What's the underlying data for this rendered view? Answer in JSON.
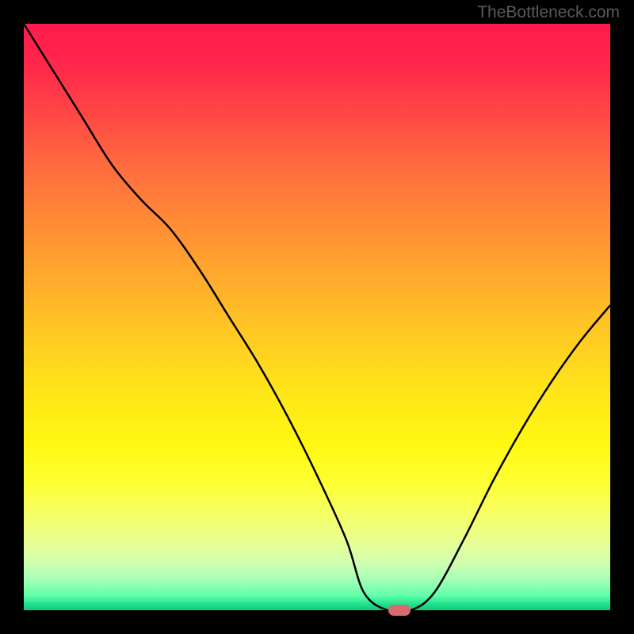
{
  "watermark": "TheBottleneck.com",
  "chart_data": {
    "type": "line",
    "title": "",
    "xlabel": "",
    "ylabel": "",
    "xlim": [
      0,
      100
    ],
    "ylim": [
      0,
      100
    ],
    "x": [
      0,
      5,
      10,
      15,
      20,
      25,
      30,
      35,
      40,
      45,
      50,
      55,
      58,
      62,
      66,
      70,
      75,
      80,
      85,
      90,
      95,
      100
    ],
    "values": [
      100,
      92,
      84,
      76,
      70,
      65,
      58,
      50,
      42,
      33,
      23,
      12,
      3,
      0,
      0,
      3,
      12,
      22,
      31,
      39,
      46,
      52
    ],
    "marker": {
      "x": 64,
      "y": 0
    },
    "gradient_stops": [
      {
        "pos": 0,
        "color": "#ff1a4d"
      },
      {
        "pos": 50,
        "color": "#ffd220"
      },
      {
        "pos": 100,
        "color": "#10c878"
      }
    ]
  }
}
